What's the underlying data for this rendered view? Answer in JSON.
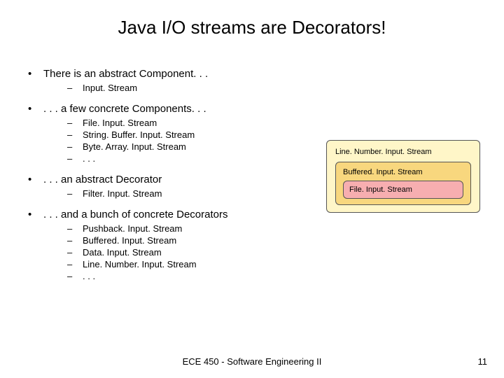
{
  "title": "Java I/O streams are Decorators!",
  "bullets": [
    {
      "text": "There is an abstract Component. . .",
      "subs": [
        "Input. Stream"
      ]
    },
    {
      "text": ". . . a few concrete Components. . .",
      "subs": [
        "File. Input. Stream",
        "String. Buffer. Input. Stream",
        "Byte. Array. Input. Stream",
        ". . ."
      ]
    },
    {
      "text": ". . . an abstract Decorator",
      "subs": [
        "Filter. Input. Stream"
      ]
    },
    {
      "text": ". . . and a bunch of concrete Decorators",
      "subs": [
        "Pushback. Input. Stream",
        "Buffered. Input. Stream",
        "Data. Input. Stream",
        "Line. Number. Input. Stream",
        ". . ."
      ]
    }
  ],
  "diagram": {
    "outer": "Line. Number. Input. Stream",
    "mid": "Buffered. Input. Stream",
    "inner": "File. Input. Stream"
  },
  "footer": "ECE 450 - Software Engineering II",
  "page": "11"
}
